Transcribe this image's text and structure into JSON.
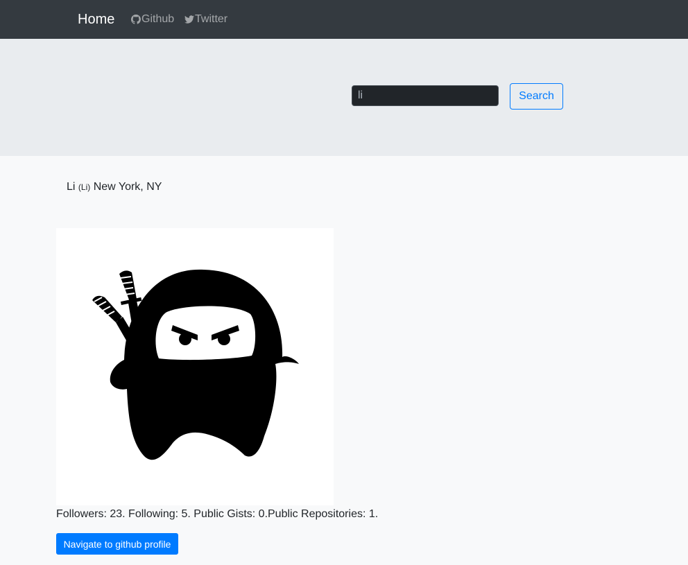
{
  "nav": {
    "brand": "Home",
    "github_label": "Github",
    "twitter_label": "Twitter"
  },
  "search": {
    "value": "li",
    "button_label": "Search"
  },
  "user": {
    "name": "Li",
    "login": "(Li)",
    "location": "New York, NY",
    "avatar_icon": "ninja-avatar-icon"
  },
  "stats": {
    "text": "Followers: 23. Following: 5. Public Gists: 0.Public Repositories: 1."
  },
  "profile_button": {
    "label": "Navigate to github profile"
  },
  "colors": {
    "navbar": "#343a40",
    "jumbotron": "#e9ecef",
    "accent": "#007bff"
  }
}
